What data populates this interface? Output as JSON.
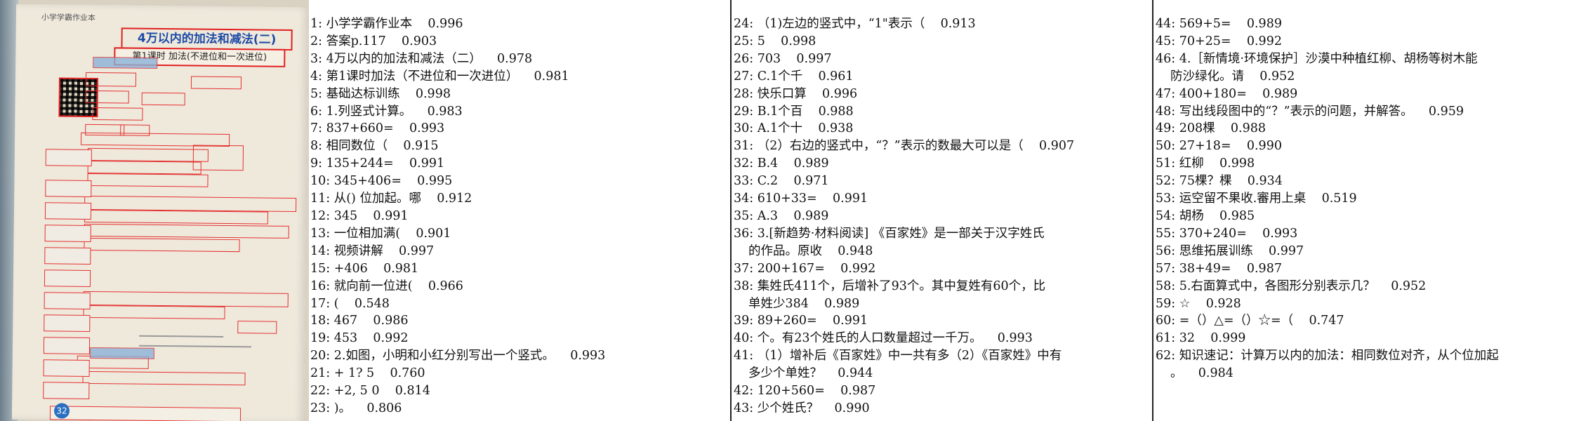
{
  "photo": {
    "page_header": "小学学霸作业本",
    "page_title": "4万以内的加法和减法(二)",
    "page_subtitle": "第1课时 加法(不进位和一次进位)",
    "page_number": "32"
  },
  "columns": [
    {
      "entries": [
        {
          "text": "1: 小学学霸作业本",
          "score": "0.996"
        },
        {
          "text": "2: 答案p.117",
          "score": "0.903"
        },
        {
          "text": "3: 4万以内的加法和减法（二）",
          "score": "0.978"
        },
        {
          "text": "4: 第1课时加法（不进位和一次进位）",
          "score": "0.981"
        },
        {
          "text": "5: 基础达标训练",
          "score": "0.998"
        },
        {
          "text": "6: 1.列竖式计算。",
          "score": "0.983"
        },
        {
          "text": "7: 837+660=",
          "score": "0.993"
        },
        {
          "text": "8: 相同数位（",
          "score": "0.915"
        },
        {
          "text": "9: 135+244=",
          "score": "0.991"
        },
        {
          "text": "10: 345+406=",
          "score": "0.995"
        },
        {
          "text": "11: 从() 位加起。哪",
          "score": "0.912"
        },
        {
          "text": "12: 345",
          "score": "0.991"
        },
        {
          "text": "13: 一位相加满(",
          "score": "0.901"
        },
        {
          "text": "14: 视频讲解",
          "score": "0.997"
        },
        {
          "text": "15: +406",
          "score": "0.981"
        },
        {
          "text": "16: 就向前一位进(",
          "score": "0.966"
        },
        {
          "text": "17: (",
          "score": "0.548"
        },
        {
          "text": "18: 467",
          "score": "0.986"
        },
        {
          "text": "19: 453",
          "score": "0.992"
        },
        {
          "text": "20: 2.如图，小明和小红分别写出一个竖式。",
          "score": "0.993"
        },
        {
          "text": "21: + 1? 5",
          "score": "0.760"
        },
        {
          "text": "22: +2, 5 0",
          "score": "0.814"
        },
        {
          "text": "23: )。",
          "score": "0.806"
        }
      ]
    },
    {
      "entries": [
        {
          "text": "24: （1)左边的竖式中，“1\"表示（",
          "score": "0.913"
        },
        {
          "text": "25: 5",
          "score": "0.998"
        },
        {
          "text": "26: 703",
          "score": "0.997"
        },
        {
          "text": "27: C.1个千",
          "score": "0.961"
        },
        {
          "text": "28: 快乐口算",
          "score": "0.996"
        },
        {
          "text": "29: B.1个百",
          "score": "0.988"
        },
        {
          "text": "30: A.1个十",
          "score": "0.938"
        },
        {
          "text": "31: （2）右边的竖式中，“？”表示的数最大可以是（",
          "score": "0.907"
        },
        {
          "text": "32: B.4",
          "score": "0.989"
        },
        {
          "text": "33: C.2",
          "score": "0.971"
        },
        {
          "text": "34: 610+33=",
          "score": "0.991"
        },
        {
          "text": "35: A.3",
          "score": "0.989"
        },
        {
          "text": "36: 3.[新趋势·材料阅读] 《百家姓》是一部关于汉字姓氏",
          "cont": "的作品。原收",
          "score": "0.948"
        },
        {
          "text": "37: 200+167=",
          "score": "0.992"
        },
        {
          "text": "38: 集姓氏411个，后增补了93个。其中复姓有60个，比",
          "cont": "单姓少384",
          "score": "0.989"
        },
        {
          "text": "39: 89+260=",
          "score": "0.991"
        },
        {
          "text": "40: 个。有23个姓氏的人口数量超过一千万。",
          "score": "0.993"
        },
        {
          "text": "41: （1）增补后《百家姓》中一共有多（2）《百家姓》中有",
          "cont": "多少个单姓？",
          "score": "0.944"
        },
        {
          "text": "42: 120+560=",
          "score": "0.987"
        },
        {
          "text": "43: 少个姓氏？",
          "score": "0.990"
        }
      ]
    },
    {
      "entries": [
        {
          "text": "44: 569+5=",
          "score": "0.989"
        },
        {
          "text": "45: 70+25=",
          "score": "0.992"
        },
        {
          "text": "46: 4.［新情境·环境保护］沙漠中种植红柳、胡杨等树木能",
          "cont": "防沙绿化。请",
          "score": "0.952"
        },
        {
          "text": "47: 400+180=",
          "score": "0.989"
        },
        {
          "text": "48: 写出线段图中的“？”表示的问题，并解答。",
          "score": "0.959"
        },
        {
          "text": "49: 208棵",
          "score": "0.988"
        },
        {
          "text": "50: 27+18=",
          "score": "0.990"
        },
        {
          "text": "51: 红柳",
          "score": "0.998"
        },
        {
          "text": "52: 75棵？棵",
          "score": "0.934"
        },
        {
          "text": "53: 运空留不果收.審用上桌",
          "score": "0.519"
        },
        {
          "text": "54: 胡杨",
          "score": "0.985"
        },
        {
          "text": "55: 370+240=",
          "score": "0.993"
        },
        {
          "text": "56: 思维拓展训练",
          "score": "0.997"
        },
        {
          "text": "57: 38+49=",
          "score": "0.987"
        },
        {
          "text": "58: 5.右面算式中，各图形分别表示几？",
          "score": "0.952"
        },
        {
          "text": "59: ☆",
          "score": "0.928"
        },
        {
          "text": "60: =（）△=（）☆=（",
          "score": "0.747"
        },
        {
          "text": "61: 32",
          "score": "0.999"
        },
        {
          "text": "62: 知识速记：计算万以内的加法：相同数位对齐，从个位加起",
          "cont": "。",
          "score": "0.984"
        }
      ]
    }
  ]
}
